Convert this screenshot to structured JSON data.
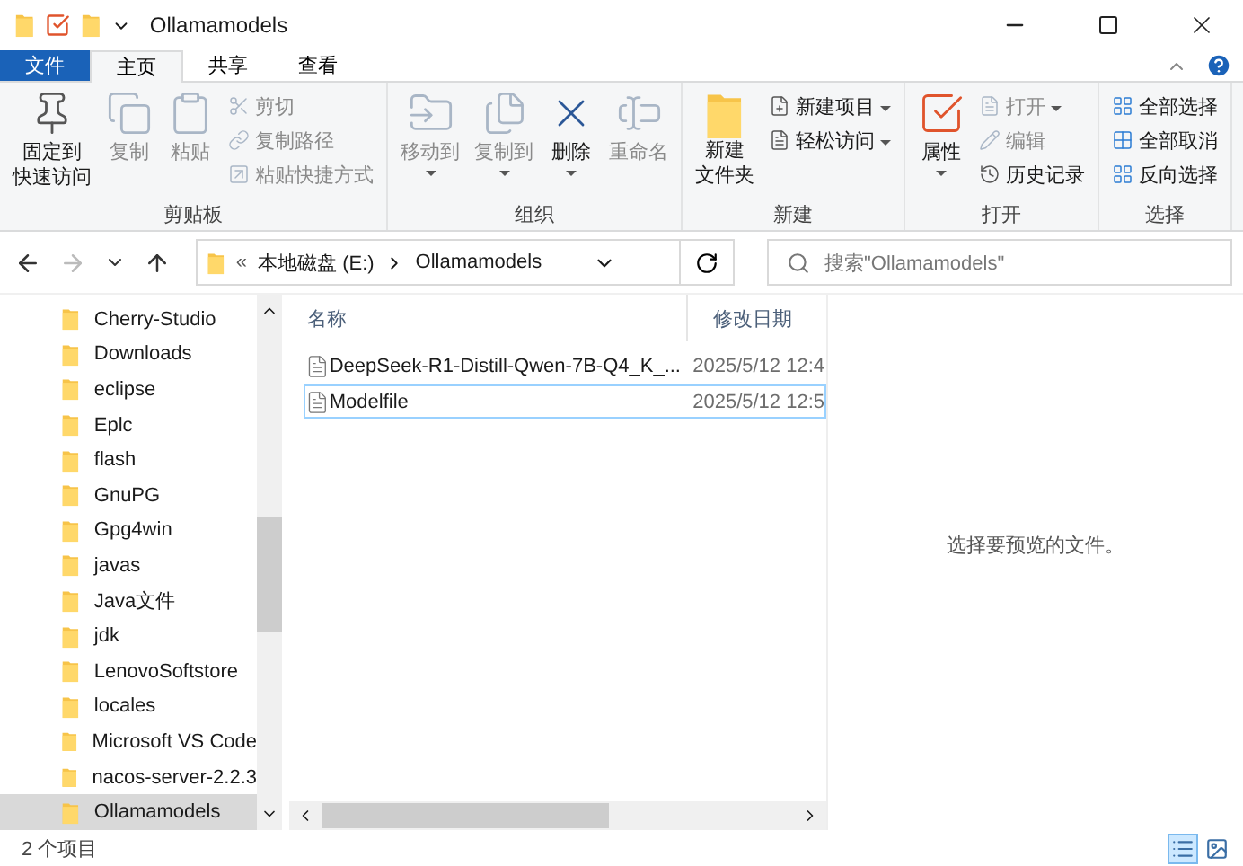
{
  "window": {
    "title": "Ollamamodels"
  },
  "ribbon_tabs": [
    {
      "label": "文件",
      "kind": "file",
      "selected": false
    },
    {
      "label": "主页",
      "kind": "tab",
      "selected": true
    },
    {
      "label": "共享",
      "kind": "tab",
      "selected": false
    },
    {
      "label": "查看",
      "kind": "tab",
      "selected": false
    }
  ],
  "ribbon_groups": [
    {
      "label": "剪贴板",
      "large_commands": [
        {
          "lines": [
            "固定到",
            "快速访问"
          ],
          "disabled": false,
          "dropdown": false
        },
        {
          "lines": [
            "复制"
          ],
          "disabled": true,
          "dropdown": false
        },
        {
          "lines": [
            "粘贴"
          ],
          "disabled": true,
          "dropdown": false
        }
      ],
      "small_commands": [
        {
          "label": "剪切",
          "disabled": true,
          "dropdown": false
        },
        {
          "label": "复制路径",
          "disabled": true,
          "dropdown": false
        },
        {
          "label": "粘贴快捷方式",
          "disabled": true,
          "dropdown": false
        }
      ]
    },
    {
      "label": "组织",
      "large_commands": [
        {
          "lines": [
            "移动到"
          ],
          "disabled": true,
          "dropdown": true
        },
        {
          "lines": [
            "复制到"
          ],
          "disabled": true,
          "dropdown": true
        },
        {
          "lines": [
            "删除"
          ],
          "disabled": false,
          "dropdown": true
        },
        {
          "lines": [
            "重命名"
          ],
          "disabled": true,
          "dropdown": false
        }
      ]
    },
    {
      "label": "新建",
      "large_commands": [
        {
          "lines": [
            "新建",
            "文件夹"
          ],
          "disabled": false,
          "dropdown": false
        }
      ],
      "small_commands": [
        {
          "label": "新建项目",
          "disabled": false,
          "dropdown": true
        },
        {
          "label": "轻松访问",
          "disabled": false,
          "dropdown": true
        }
      ]
    },
    {
      "label": "打开",
      "large_commands": [
        {
          "lines": [
            "属性"
          ],
          "disabled": false,
          "dropdown": true
        }
      ],
      "small_commands": [
        {
          "label": "打开",
          "disabled": true,
          "dropdown": true
        },
        {
          "label": "编辑",
          "disabled": true,
          "dropdown": false
        },
        {
          "label": "历史记录",
          "disabled": false,
          "dropdown": false
        }
      ]
    },
    {
      "label": "选择",
      "small_commands": [
        {
          "label": "全部选择",
          "disabled": false,
          "dropdown": false
        },
        {
          "label": "全部取消",
          "disabled": false,
          "dropdown": false
        },
        {
          "label": "反向选择",
          "disabled": false,
          "dropdown": false
        }
      ]
    }
  ],
  "navigation": {
    "back_disabled": false,
    "forward_disabled": true
  },
  "address": {
    "overflow": "«",
    "path": [
      "本地磁盘 (E:)",
      "Ollamamodels"
    ]
  },
  "search": {
    "placeholder": "搜索\"Ollamamodels\""
  },
  "sidebar": {
    "items": [
      {
        "label": "Cherry-Studio",
        "selected": false
      },
      {
        "label": "Downloads",
        "selected": false
      },
      {
        "label": "eclipse",
        "selected": false
      },
      {
        "label": "Eplc",
        "selected": false
      },
      {
        "label": "flash",
        "selected": false
      },
      {
        "label": "GnuPG",
        "selected": false
      },
      {
        "label": "Gpg4win",
        "selected": false
      },
      {
        "label": "javas",
        "selected": false
      },
      {
        "label": "Java文件",
        "selected": false
      },
      {
        "label": "jdk",
        "selected": false
      },
      {
        "label": "LenovoSoftstore",
        "selected": false
      },
      {
        "label": "locales",
        "selected": false
      },
      {
        "label": "Microsoft VS Code",
        "selected": false
      },
      {
        "label": "nacos-server-2.2.3",
        "selected": false
      },
      {
        "label": "Ollamamodels",
        "selected": true
      }
    ]
  },
  "file_list": {
    "columns": [
      "名称",
      "修改日期"
    ],
    "rows": [
      {
        "name": "DeepSeek-R1-Distill-Qwen-7B-Q4_K_...",
        "date": "2025/5/12 12:4",
        "selected": false,
        "focused": false
      },
      {
        "name": "Modelfile",
        "date": "2025/5/12 12:5",
        "selected": false,
        "focused": true
      }
    ]
  },
  "preview": {
    "message": "选择要预览的文件。"
  },
  "status_bar": {
    "count": "2 个项目",
    "views": [
      {
        "kind": "details",
        "selected": true
      },
      {
        "kind": "large_icons",
        "selected": false
      }
    ]
  }
}
